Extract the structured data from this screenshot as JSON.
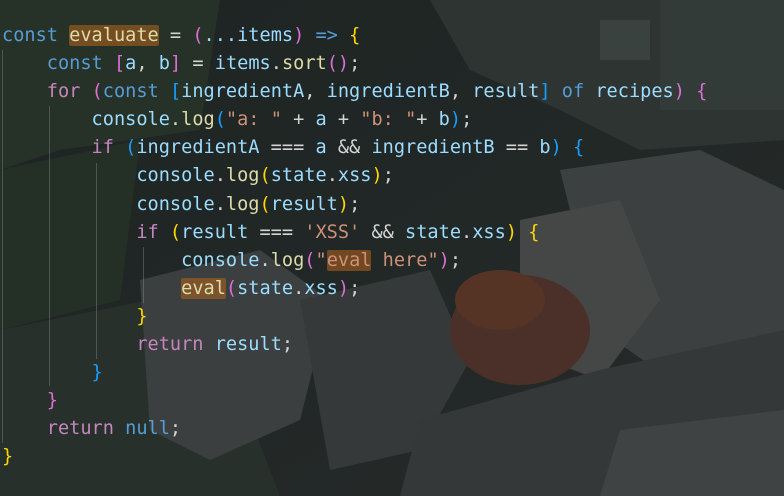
{
  "editor": {
    "colors": {
      "keyword": "#569cd6",
      "control": "#c586c0",
      "variable": "#9cdcfe",
      "function": "#dcdcaa",
      "string": "#ce9178",
      "default": "#d4d4d4",
      "bracket_gold": "#ffd700",
      "bracket_purple": "#da70d6",
      "bracket_blue": "#179fff",
      "highlight": "#b5641e"
    },
    "lines": [
      [
        [
          "const ",
          "keyword"
        ],
        [
          "evaluate",
          "function",
          "hl"
        ],
        [
          " = ",
          "default"
        ],
        [
          "(",
          "bracket_purple"
        ],
        [
          "...items",
          "variable"
        ],
        [
          ")",
          "bracket_purple"
        ],
        [
          " => ",
          "keyword"
        ],
        [
          "{",
          "bracket_gold"
        ]
      ],
      [
        [
          "    const ",
          "keyword"
        ],
        [
          "[",
          "bracket_purple"
        ],
        [
          "a",
          "variable"
        ],
        [
          ", ",
          "default"
        ],
        [
          "b",
          "variable"
        ],
        [
          "]",
          "bracket_purple"
        ],
        [
          " = ",
          "default"
        ],
        [
          "items",
          "variable"
        ],
        [
          ".",
          "default"
        ],
        [
          "sort",
          "function"
        ],
        [
          "()",
          "bracket_purple"
        ],
        [
          ";",
          "default"
        ]
      ],
      [
        [
          "    for ",
          "control"
        ],
        [
          "(",
          "bracket_purple"
        ],
        [
          "const ",
          "keyword"
        ],
        [
          "[",
          "bracket_blue"
        ],
        [
          "ingredientA",
          "variable"
        ],
        [
          ", ",
          "default"
        ],
        [
          "ingredientB",
          "variable"
        ],
        [
          ", ",
          "default"
        ],
        [
          "result",
          "variable"
        ],
        [
          "]",
          "bracket_blue"
        ],
        [
          " of ",
          "keyword"
        ],
        [
          "recipes",
          "variable"
        ],
        [
          ")",
          "bracket_purple"
        ],
        [
          " {",
          "bracket_purple"
        ]
      ],
      [
        [
          "        console",
          "variable"
        ],
        [
          ".",
          "default"
        ],
        [
          "log",
          "function"
        ],
        [
          "(",
          "bracket_blue"
        ],
        [
          "\"a: \"",
          "string"
        ],
        [
          " + ",
          "default"
        ],
        [
          "a",
          "variable"
        ],
        [
          " + ",
          "default"
        ],
        [
          "\"b: \"",
          "string"
        ],
        [
          "+ ",
          "default"
        ],
        [
          "b",
          "variable"
        ],
        [
          ")",
          "bracket_blue"
        ],
        [
          ";",
          "default"
        ]
      ],
      [
        [
          "        if ",
          "control"
        ],
        [
          "(",
          "bracket_blue"
        ],
        [
          "ingredientA",
          "variable"
        ],
        [
          " === ",
          "default"
        ],
        [
          "a",
          "variable"
        ],
        [
          " && ",
          "default"
        ],
        [
          "ingredientB",
          "variable"
        ],
        [
          " == ",
          "default"
        ],
        [
          "b",
          "variable"
        ],
        [
          ")",
          "bracket_blue"
        ],
        [
          " {",
          "bracket_blue"
        ]
      ],
      [
        [
          "            console",
          "variable"
        ],
        [
          ".",
          "default"
        ],
        [
          "log",
          "function"
        ],
        [
          "(",
          "bracket_gold"
        ],
        [
          "state",
          "variable"
        ],
        [
          ".",
          "default"
        ],
        [
          "xss",
          "variable"
        ],
        [
          ")",
          "bracket_gold"
        ],
        [
          ";",
          "default"
        ]
      ],
      [
        [
          "            console",
          "variable"
        ],
        [
          ".",
          "default"
        ],
        [
          "log",
          "function"
        ],
        [
          "(",
          "bracket_gold"
        ],
        [
          "result",
          "variable"
        ],
        [
          ")",
          "bracket_gold"
        ],
        [
          ";",
          "default"
        ]
      ],
      [
        [
          "            if ",
          "control"
        ],
        [
          "(",
          "bracket_gold"
        ],
        [
          "result",
          "variable"
        ],
        [
          " === ",
          "default"
        ],
        [
          "'XSS'",
          "string"
        ],
        [
          " && ",
          "default"
        ],
        [
          "state",
          "variable"
        ],
        [
          ".",
          "default"
        ],
        [
          "xss",
          "variable"
        ],
        [
          ")",
          "bracket_gold"
        ],
        [
          " {",
          "bracket_gold"
        ]
      ],
      [
        [
          "                console",
          "variable"
        ],
        [
          ".",
          "default"
        ],
        [
          "log",
          "function"
        ],
        [
          "(",
          "bracket_purple"
        ],
        [
          "\"",
          "string"
        ],
        [
          "eval",
          "string",
          "hl"
        ],
        [
          " here\"",
          "string"
        ],
        [
          ")",
          "bracket_purple"
        ],
        [
          ";",
          "default"
        ]
      ],
      [
        [
          "                ",
          "default"
        ],
        [
          "eval",
          "function",
          "hl"
        ],
        [
          "(",
          "bracket_purple"
        ],
        [
          "state",
          "variable"
        ],
        [
          ".",
          "default"
        ],
        [
          "xss",
          "variable"
        ],
        [
          ")",
          "bracket_purple"
        ],
        [
          ";",
          "default"
        ]
      ],
      [
        [
          "            }",
          "bracket_gold"
        ]
      ],
      [
        [
          "            return ",
          "control"
        ],
        [
          "result",
          "variable"
        ],
        [
          ";",
          "default"
        ]
      ],
      [
        [
          "        }",
          "bracket_blue"
        ]
      ],
      [
        [
          "    }",
          "bracket_purple"
        ]
      ],
      [
        [
          "    return ",
          "control"
        ],
        [
          "null",
          "keyword"
        ],
        [
          ";",
          "default"
        ]
      ],
      [
        [
          "}",
          "bracket_gold"
        ]
      ]
    ]
  }
}
